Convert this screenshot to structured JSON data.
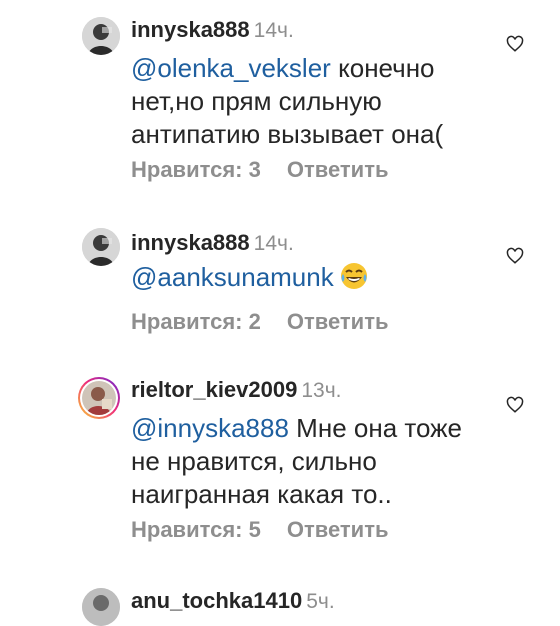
{
  "comments": [
    {
      "username": "innyska888",
      "time": "14ч.",
      "mention": "@olenka_veksler",
      "text": "конечно нет,но прям сильную антипатию вызывает она(",
      "likes_label": "Нравится: 3",
      "reply_label": "Ответить",
      "emoji": null
    },
    {
      "username": "innyska888",
      "time": "14ч.",
      "mention": "@aanksunamunk",
      "text": "",
      "likes_label": "Нравится: 2",
      "reply_label": "Ответить",
      "emoji": "face-with-tears-of-joy"
    },
    {
      "username": "rieltor_kiev2009",
      "time": "13ч.",
      "mention": "@innyska888",
      "text": " Мне она тоже не нравится, сильно наигранная какая то..",
      "likes_label": "Нравится: 5",
      "reply_label": "Ответить",
      "emoji": null
    },
    {
      "username": "anu_tochka1410",
      "time": "5ч.",
      "mention": "",
      "text": "",
      "likes_label": "",
      "reply_label": "",
      "emoji": null
    }
  ],
  "icons": {
    "like": "heart-outline-icon",
    "story_ring": "gradient-ring"
  },
  "colors": {
    "mention": "#1f5f9f",
    "meta": "#8e8e8e",
    "text": "#262626"
  }
}
